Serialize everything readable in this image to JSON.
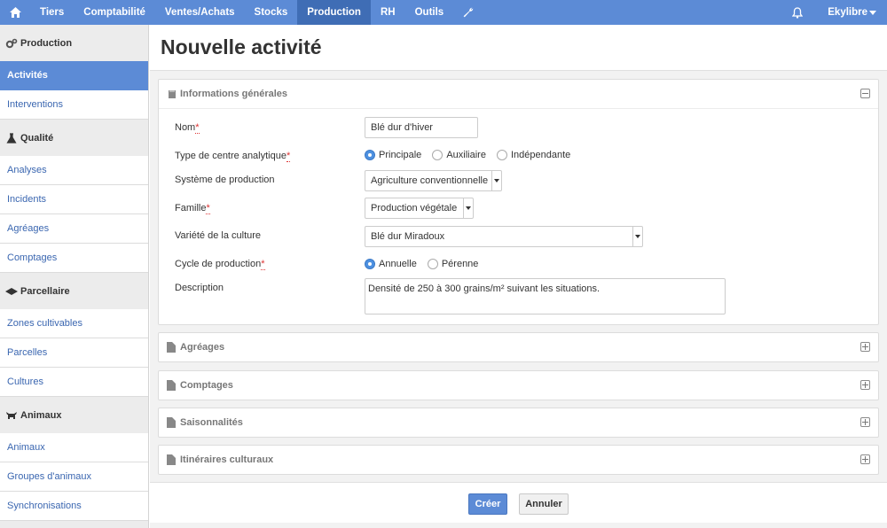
{
  "topnav": {
    "items": [
      "Tiers",
      "Comptabilité",
      "Ventes/Achats",
      "Stocks",
      "Production",
      "RH",
      "Outils"
    ],
    "active": "Production",
    "user": "Ekylibre"
  },
  "sidebar": {
    "sections": [
      {
        "title": "Production",
        "items": [
          "Activités",
          "Interventions"
        ]
      },
      {
        "title": "Qualité",
        "items": [
          "Analyses",
          "Incidents",
          "Agréages",
          "Comptages"
        ]
      },
      {
        "title": "Parcellaire",
        "items": [
          "Zones cultivables",
          "Parcelles",
          "Cultures"
        ]
      },
      {
        "title": "Animaux",
        "items": [
          "Animaux",
          "Groupes d'animaux",
          "Synchronisations"
        ]
      }
    ],
    "active_item": "Activités"
  },
  "page": {
    "title": "Nouvelle activité"
  },
  "general_panel": {
    "title": "Informations générales",
    "fields": {
      "nom": {
        "label": "Nom",
        "value": "Blé dur d'hiver"
      },
      "type_centre": {
        "label": "Type de centre analytique",
        "options": [
          "Principale",
          "Auxiliaire",
          "Indépendante"
        ],
        "selected": "Principale"
      },
      "systeme": {
        "label": "Système de production",
        "value": "Agriculture conventionnelle"
      },
      "famille": {
        "label": "Famille",
        "value": "Production végétale"
      },
      "variete": {
        "label": "Variété de la culture",
        "value": "Blé dur Miradoux"
      },
      "cycle": {
        "label": "Cycle de production",
        "options": [
          "Annuelle",
          "Pérenne"
        ],
        "selected": "Annuelle"
      },
      "description": {
        "label": "Description",
        "value": "Densité de 250 à 300 grains/m² suivant les situations."
      }
    }
  },
  "collapsed_panels": [
    "Agréages",
    "Comptages",
    "Saisonnalités",
    "Itinéraires culturaux"
  ],
  "buttons": {
    "create": "Créer",
    "cancel": "Annuler"
  }
}
